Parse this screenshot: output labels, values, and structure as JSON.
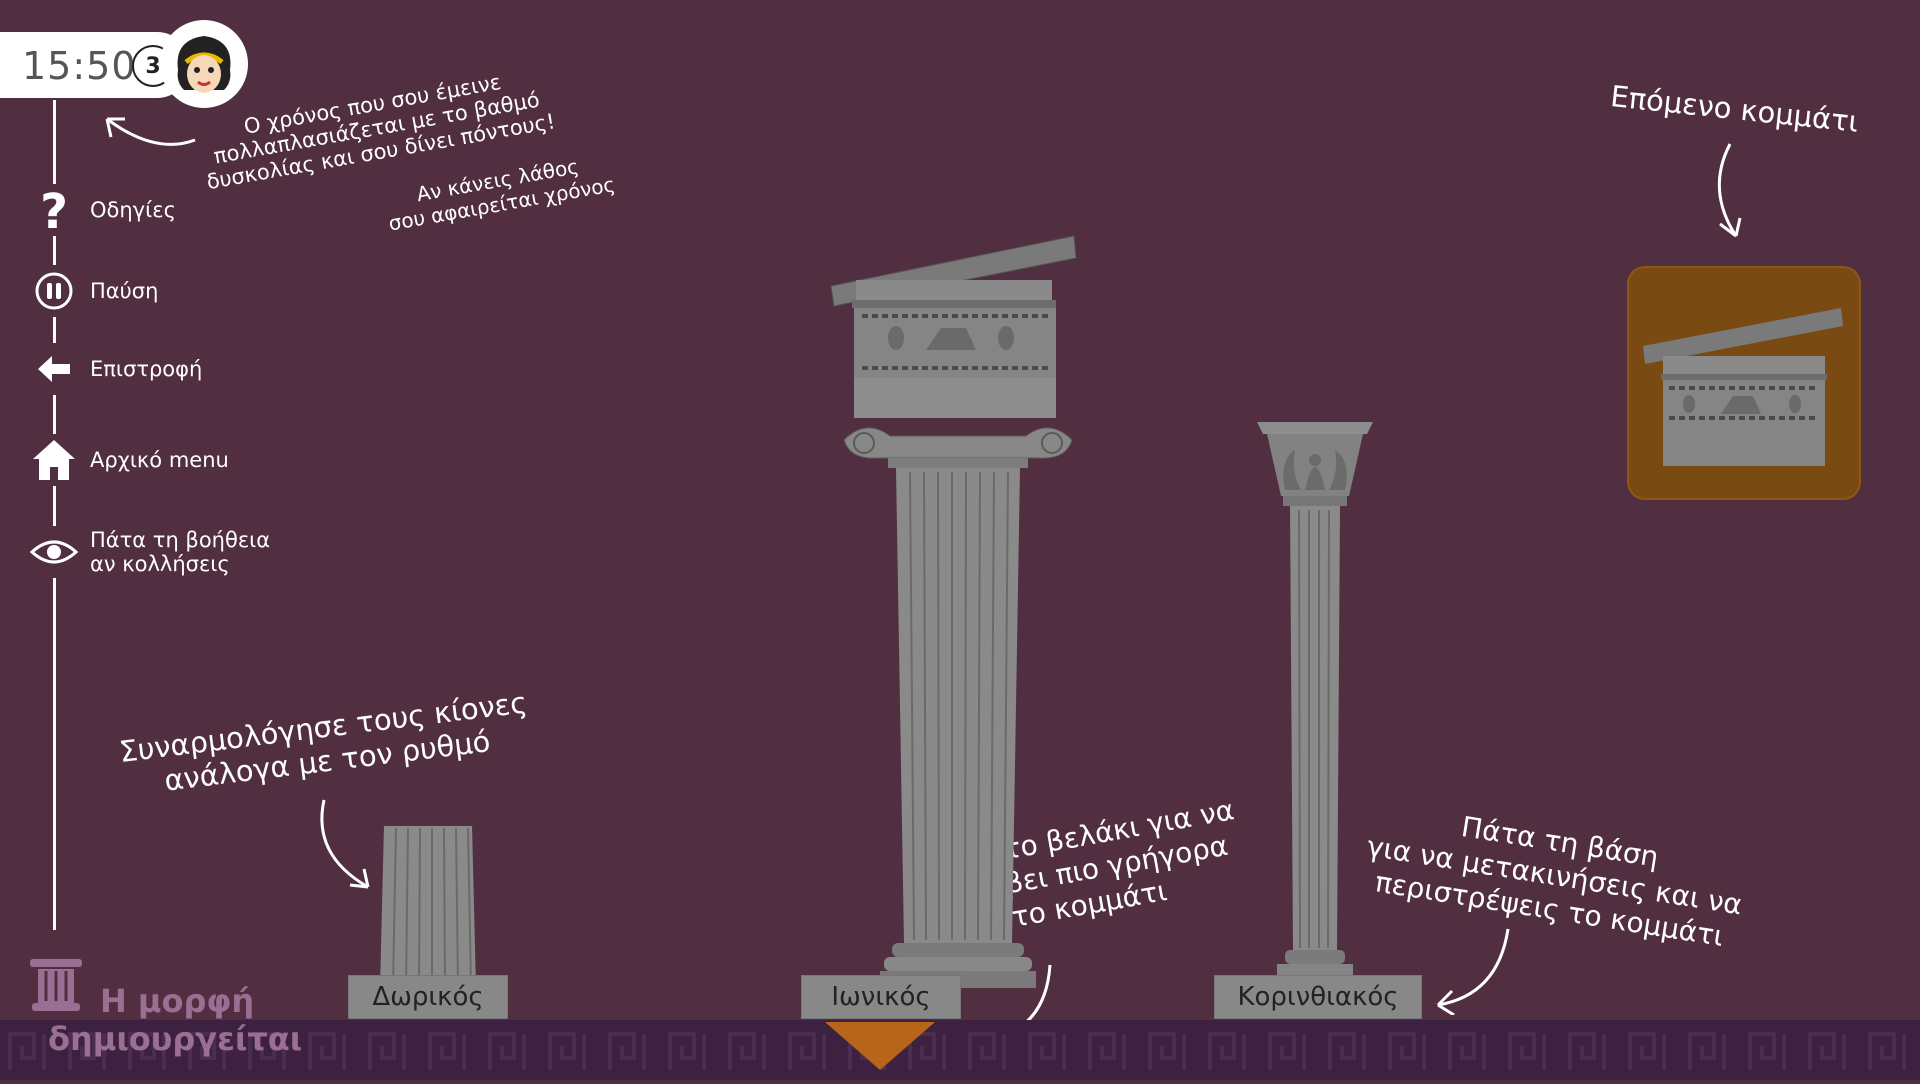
{
  "hud": {
    "timer": "15:50",
    "level": "3"
  },
  "sidebar": {
    "items": [
      {
        "label": "Οδηγίες",
        "icon": "question-icon"
      },
      {
        "label": "Παύση",
        "icon": "pause-icon"
      },
      {
        "label": "Επιστροφή",
        "icon": "back-arrow-icon"
      },
      {
        "label": "Αρχικό menu",
        "icon": "home-icon"
      },
      {
        "label_line1": "Πάτα τη βοήθεια",
        "label_line2": "αν κολλήσεις",
        "icon": "eye-icon"
      }
    ]
  },
  "notes": {
    "timer_hint_line1": "Ο χρόνος που σου έμεινε",
    "timer_hint_line2": "πολλαπλασιάζεται με το βαθμό",
    "timer_hint_line3": "δυσκολίας και σου δίνει πόντους!",
    "mistake_line1": "Αν κάνεις λάθος",
    "mistake_line2": "σου αφαιρείται χρόνος",
    "assemble_line1": "Συναρμολόγησε τους κίονες",
    "assemble_line2": "ανάλογα με τον ρυθμό",
    "arrow_line1": "Πάτα το βελάκι για να",
    "arrow_line2": "κατέβει πιο γρήγορα",
    "arrow_line3": "το κομμάτι",
    "base_line1": "Πάτα τη βάση",
    "base_line2": "για να μετακινήσεις και να",
    "base_line3": "περιστρέψεις το κομμάτι",
    "next_piece": "Επόμενο κομμάτι"
  },
  "columns": [
    {
      "label": "Δωρικός"
    },
    {
      "label": "Ιωνικός"
    },
    {
      "label": "Κορινθιακός"
    }
  ],
  "brand": {
    "line1": "Η μορφή",
    "line2": "δημιουργείται"
  },
  "colors": {
    "background": "#512f40",
    "band": "#3c2240",
    "next_tile": "#7a4a13",
    "drop_arrow": "#b8651a",
    "stone": "#858585"
  }
}
